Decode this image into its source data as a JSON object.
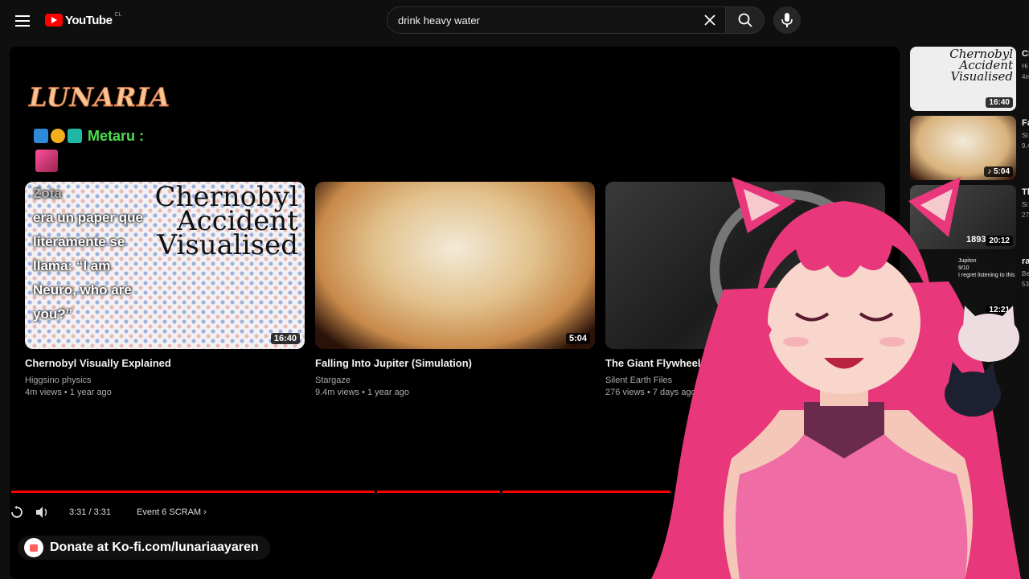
{
  "header": {
    "logo_text": "YouTube",
    "region": "CL",
    "search_value": "drink heavy water"
  },
  "overlay": {
    "streamer_logo": "LUNARIA",
    "chat_user": "Metaru :",
    "chat_message_user": "Zota",
    "chat_message_lines": [
      "era un paper que",
      "literamente se",
      "llama: “I am",
      "Neuro, who are",
      "you?”"
    ],
    "donate_text": "Donate at Ko-fi.com/lunariaayaren"
  },
  "videos": [
    {
      "title": "Chernobyl Visually Explained",
      "channel": "Higgsino physics",
      "meta": "4m views • 1 year ago",
      "duration": "16:40",
      "thumb_text": [
        "Chernobyl",
        "Accident",
        "Visualised"
      ]
    },
    {
      "title": "Falling Into Jupiter (Simulation)",
      "channel": "Stargaze",
      "meta": "9.4m views • 1 year ago",
      "duration": "5:04"
    },
    {
      "title": "The Giant Flywheel",
      "channel": "Silent Earth Files",
      "meta": "276 views • 7 days ago",
      "thumb_text": "18"
    }
  ],
  "player": {
    "time": "3:31 / 3:31",
    "chapter": "Event 6 SCRAM",
    "progress": 1.0
  },
  "sidebar": [
    {
      "title": "Ch",
      "channel": "Hi",
      "meta": "4m",
      "duration": "16:40",
      "thumb_text": [
        "Chernobyl",
        "Accident",
        "Visualised"
      ]
    },
    {
      "title": "Fa",
      "channel": "St",
      "meta": "9.4",
      "duration": "5:04"
    },
    {
      "title": "Th",
      "channel": "Si",
      "meta": "27",
      "duration": "20:12",
      "thumb_text": "1893"
    },
    {
      "title": "ra",
      "channel": "Be",
      "meta": "53",
      "duration": "12:21",
      "caption": [
        "Jupiton",
        "9/10",
        "I regret listening to this"
      ]
    }
  ],
  "colors": {
    "accent": "#ff0000",
    "background": "#0f0f0f",
    "chat_name": "#4cdf4f"
  }
}
